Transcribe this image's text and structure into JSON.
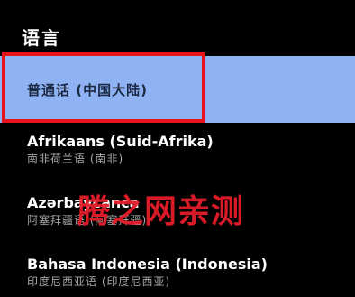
{
  "section": {
    "title": "语言"
  },
  "languages": [
    {
      "name": "普通话 (中国大陆)",
      "subtitle": "",
      "selected": true
    },
    {
      "name": "Afrikaans (Suid-Afrika)",
      "subtitle": "南非荷兰语 (南非)",
      "selected": false
    },
    {
      "name": "Azərbaycanca",
      "subtitle": "阿塞拜疆语 (阿塞拜疆)",
      "selected": false
    },
    {
      "name": "Bahasa Indonesia (Indonesia)",
      "subtitle": "印度尼西亚语 (印度尼西亚)",
      "selected": false
    }
  ],
  "watermark": {
    "text": "腾之网亲测"
  },
  "colors": {
    "background": "#000000",
    "selected_row": "#8fb2f3",
    "focus_border": "#e8121b",
    "watermark": "#e41d2a"
  }
}
